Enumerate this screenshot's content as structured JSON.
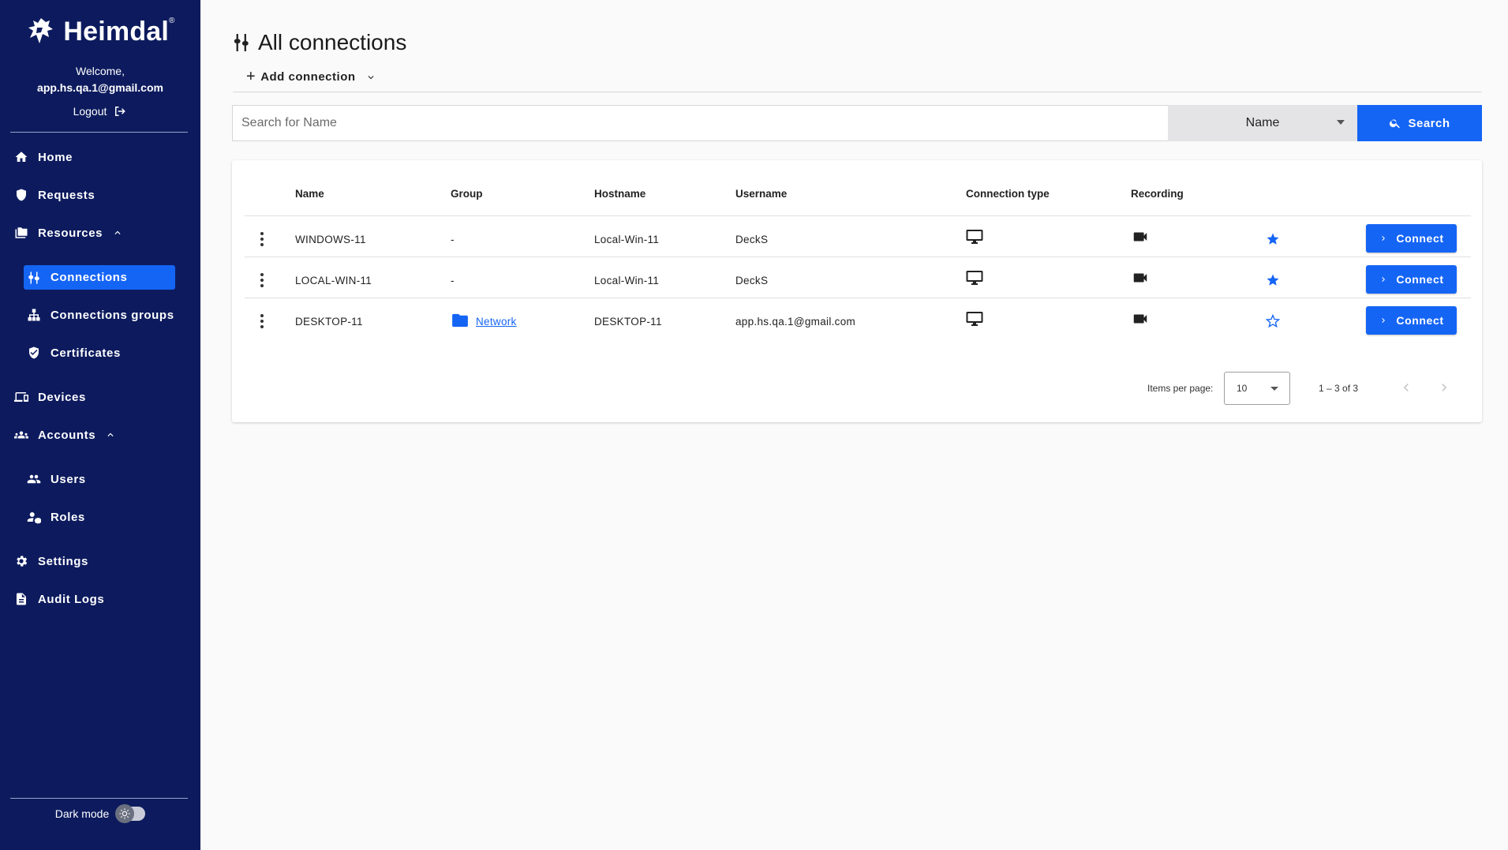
{
  "brand": {
    "name": "Heimdal",
    "trademark": "®"
  },
  "user": {
    "welcome": "Welcome,",
    "email": "app.hs.qa.1@gmail.com",
    "logout_label": "Logout"
  },
  "nav": {
    "home": "Home",
    "requests": "Requests",
    "resources": "Resources",
    "connections": "Connections",
    "connections_groups": "Connections groups",
    "certificates": "Certificates",
    "devices": "Devices",
    "accounts": "Accounts",
    "users": "Users",
    "roles": "Roles",
    "settings": "Settings",
    "audit_logs": "Audit Logs"
  },
  "dark_mode_label": "Dark mode",
  "page": {
    "title": "All connections",
    "add_connection": "Add connection"
  },
  "search": {
    "placeholder": "Search for Name",
    "field": "Name",
    "button": "Search"
  },
  "table": {
    "headers": {
      "name": "Name",
      "group": "Group",
      "hostname": "Hostname",
      "username": "Username",
      "connection_type": "Connection type",
      "recording": "Recording"
    },
    "rows": [
      {
        "name": "WINDOWS-11",
        "group": "-",
        "hostname": "Local-Win-11",
        "username": "DeckS",
        "favorite": true,
        "connect": "Connect"
      },
      {
        "name": "LOCAL-WIN-11",
        "group": "-",
        "hostname": "Local-Win-11",
        "username": "DeckS",
        "favorite": true,
        "connect": "Connect"
      },
      {
        "name": "DESKTOP-11",
        "group": "Network",
        "hostname": "DESKTOP-11",
        "username": "app.hs.qa.1@gmail.com",
        "favorite": false,
        "connect": "Connect"
      }
    ]
  },
  "pagination": {
    "items_per_page_label": "Items per page:",
    "items_per_page": "10",
    "range": "1 – 3 of 3"
  },
  "colors": {
    "sidebar": "#0d1b5e",
    "accent": "#1565f5",
    "background": "#fafafa"
  },
  "icons": {
    "connection_type": "monitor-icon",
    "recording": "video-camera-icon",
    "favorite_on": "star-filled-icon",
    "favorite_off": "star-outline-icon",
    "group": "folder-icon"
  }
}
